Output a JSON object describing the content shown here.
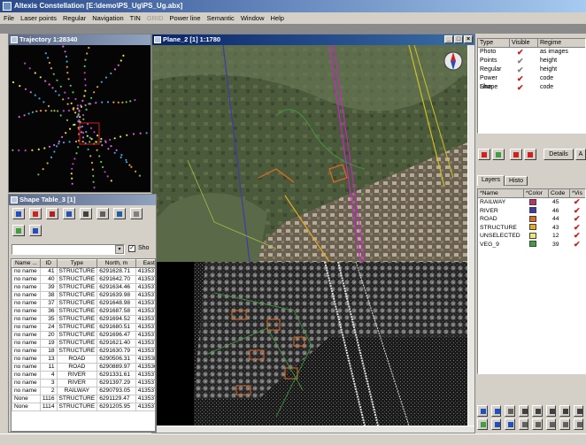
{
  "app": {
    "title": "Altexis Constellation [E:\\demo\\PS_Ug\\PS_Ug.abx]"
  },
  "menu": [
    "File",
    "Laser points",
    "Regular",
    "Navigation",
    "TIN",
    "GRID",
    "Power line",
    "Semantic",
    "Window",
    "Help"
  ],
  "trajectory": {
    "title": "Trajectory 1:28340"
  },
  "plane": {
    "title": "Plane_2 [1] 1:1780",
    "buttons": [
      "_",
      "□",
      "×"
    ]
  },
  "shape_table": {
    "title": "Shape Table_3 [1]",
    "show_label": "Sho",
    "columns": [
      "Name ...",
      "ID",
      "Type",
      "North, m",
      "East, m"
    ],
    "rows": [
      [
        "no name",
        "41",
        "STRUCTURE",
        "6291628.71",
        "41353742"
      ],
      [
        "no name",
        "40",
        "STRUCTURE",
        "6291642.70",
        "41353732"
      ],
      [
        "no name",
        "39",
        "STRUCTURE",
        "6291634.46",
        "41353730"
      ],
      [
        "no name",
        "38",
        "STRUCTURE",
        "6291639.98",
        "41353715"
      ],
      [
        "no name",
        "37",
        "STRUCTURE",
        "6291648.98",
        "41353711"
      ],
      [
        "no name",
        "36",
        "STRUCTURE",
        "6291687.58",
        "41353752"
      ],
      [
        "no name",
        "35",
        "STRUCTURE",
        "6291694.52",
        "41353734"
      ],
      [
        "no name",
        "24",
        "STRUCTURE",
        "6291680.51",
        "41353768"
      ],
      [
        "no name",
        "20",
        "STRUCTURE",
        "6291696.47",
        "41353756"
      ],
      [
        "no name",
        "19",
        "STRUCTURE",
        "6291621.40",
        "41353756"
      ],
      [
        "no name",
        "18",
        "STRUCTURE",
        "6291630.79",
        "41353760"
      ],
      [
        "no name",
        "13",
        "ROAD",
        "6290506.31",
        "41353855"
      ],
      [
        "no name",
        "11",
        "ROAD",
        "6290889.97",
        "41353685"
      ],
      [
        "no name",
        "4",
        "RIVER",
        "6291331.61",
        "41353700"
      ],
      [
        "no name",
        "3",
        "RIVER",
        "6291397.29",
        "41353718"
      ],
      [
        "no name",
        "2",
        "RAILWAY",
        "6290793.05",
        "41353733"
      ],
      [
        "None",
        "1116",
        "STRUCTURE",
        "6291129.47",
        "41353733"
      ],
      [
        "None",
        "1114",
        "STRUCTURE",
        "6291205.95",
        "41353739"
      ]
    ]
  },
  "layer_types": {
    "columns": [
      "Type",
      "Visible",
      "Regime"
    ],
    "rows": [
      {
        "type": "Photo",
        "visible": "✔",
        "regime": "as images",
        "active": true
      },
      {
        "type": "Points",
        "visible": "✔",
        "regime": "height",
        "active": false
      },
      {
        "type": "Regular",
        "visible": "✔",
        "regime": "height",
        "active": false
      },
      {
        "type": "Power Line",
        "visible": "✔",
        "regime": "code",
        "active": true
      },
      {
        "type": "Shape",
        "visible": "✔",
        "regime": "code",
        "active": true
      }
    ]
  },
  "right_toolbar": {
    "details": "Details",
    "a": "A"
  },
  "layers": {
    "tabs": [
      "Layers",
      "Histo"
    ],
    "columns": [
      "*Name",
      "*Color",
      "Code",
      "*Vis"
    ],
    "rows": [
      {
        "name": "RAILWAY",
        "color": "#c0306a",
        "code": "45"
      },
      {
        "name": "RIVER",
        "color": "#3c3ca8",
        "code": "46"
      },
      {
        "name": "ROAD",
        "color": "#e06a20",
        "code": "44"
      },
      {
        "name": "STRUCTURE",
        "color": "#e8a820",
        "code": "43"
      },
      {
        "name": "UNSELECTED",
        "color": "#f0e868",
        "code": "12"
      },
      {
        "name": "VEG_9",
        "color": "#40a040",
        "code": "39"
      }
    ]
  }
}
